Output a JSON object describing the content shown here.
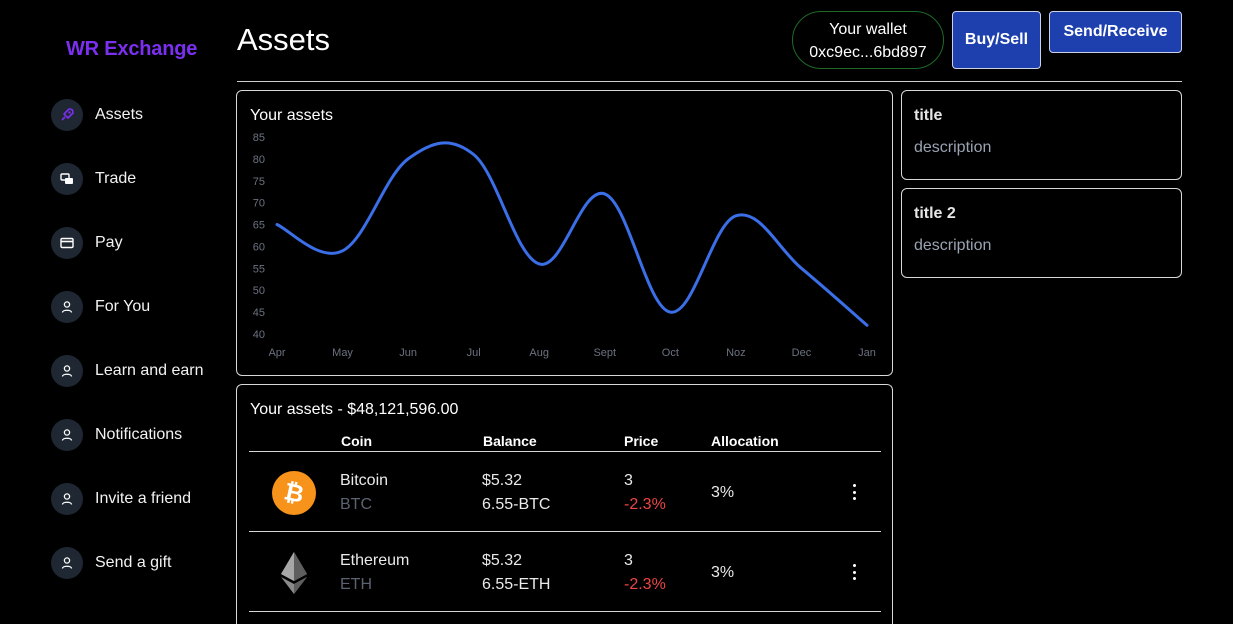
{
  "app": {
    "title": "WR Exchange"
  },
  "sidebar": {
    "items": [
      {
        "label": "Assets",
        "icon": "rocket-icon",
        "active": true
      },
      {
        "label": "Trade",
        "icon": "exchange-icon"
      },
      {
        "label": "Pay",
        "icon": "credit-card-icon"
      },
      {
        "label": "For You",
        "icon": "user-icon"
      },
      {
        "label": "Learn and earn",
        "icon": "user-icon"
      },
      {
        "label": "Notifications",
        "icon": "user-icon"
      },
      {
        "label": "Invite a friend",
        "icon": "user-icon"
      },
      {
        "label": "Send a gift",
        "icon": "user-icon"
      }
    ]
  },
  "header": {
    "title": "Assets",
    "wallet_title": "Your wallet",
    "wallet_address": "0xc9ec...6bd897",
    "buy_sell_label": "Buy/Sell",
    "send_receive_label": "Send/Receive"
  },
  "colors": {
    "accent": "#7b2ff0",
    "button": "#1e40af",
    "line": "#3b6fe8",
    "negative": "#ef4444",
    "wallet_border": "#1f6a2a"
  },
  "chart_data": {
    "type": "line",
    "title": "Your assets",
    "categories": [
      "Apr",
      "May",
      "Jun",
      "Jul",
      "Aug",
      "Sept",
      "Oct",
      "Noz",
      "Dec",
      "Jan"
    ],
    "values": [
      65,
      59,
      80,
      81,
      56,
      72,
      45,
      67,
      55,
      42
    ],
    "yticks": [
      40,
      45,
      50,
      55,
      60,
      65,
      70,
      75,
      80,
      85
    ],
    "ylim": [
      40,
      85
    ],
    "xlabel": "",
    "ylabel": "",
    "grid": false,
    "legend": "none"
  },
  "cards": [
    {
      "title": "title",
      "description": "description"
    },
    {
      "title": "title 2",
      "description": "description"
    }
  ],
  "table": {
    "title": "Your assets - $48,121,596.00",
    "headers": [
      "Coin",
      "Balance",
      "Price",
      "Allocation"
    ],
    "rows": [
      {
        "name": "Bitcoin",
        "symbol": "BTC",
        "balance_usd": "$5.32",
        "balance_coin": "6.55-BTC",
        "price": "3",
        "change": "-2.3%",
        "allocation": "3%",
        "icon": "bitcoin-icon"
      },
      {
        "name": "Ethereum",
        "symbol": "ETH",
        "balance_usd": "$5.32",
        "balance_coin": "6.55-ETH",
        "price": "3",
        "change": "-2.3%",
        "allocation": "3%",
        "icon": "ethereum-icon"
      }
    ]
  }
}
